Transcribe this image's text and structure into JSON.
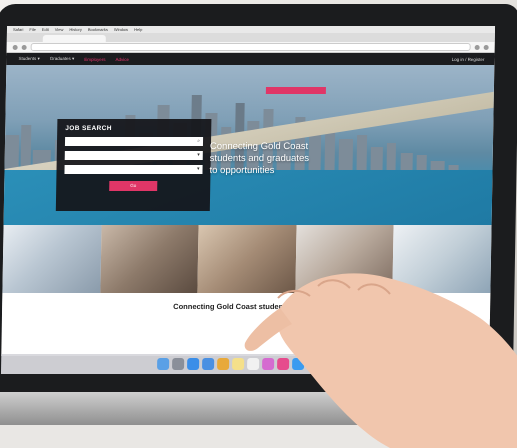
{
  "browser": {
    "menus": [
      "Safari",
      "File",
      "Edit",
      "View",
      "History",
      "Bookmarks",
      "Window",
      "Help"
    ],
    "tab_title": "",
    "url": ""
  },
  "site": {
    "nav": [
      "Students ▾",
      "Graduates ▾",
      "Employers",
      "Advice"
    ],
    "nav_right": "Log in / Register",
    "promo_text": "",
    "promo_cta": ""
  },
  "search_panel": {
    "title": "JOB SEARCH",
    "advanced": "",
    "keyword_placeholder": "",
    "type_placeholder": "",
    "industry_placeholder": "",
    "button_label": "Go"
  },
  "hero_tagline": [
    "Connecting Gold Coast",
    "students and graduates",
    "to opportunities"
  ],
  "section_heading": "Connecting Gold Coast students and gra",
  "colors": {
    "accent": "#e03667",
    "nav_bg": "#1b1c1f"
  },
  "dock_icons": [
    "finder-icon",
    "launchpad-icon",
    "safari-icon",
    "mail-icon",
    "chrome-icon",
    "notes-icon",
    "calendar-icon",
    "photos-icon",
    "itunes-icon",
    "appstore-icon",
    "settings-icon",
    "acrobat-icon"
  ]
}
